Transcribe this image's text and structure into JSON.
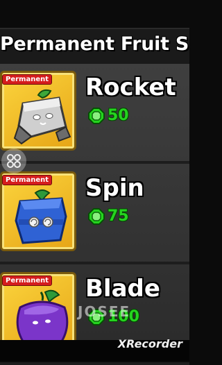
{
  "header": {
    "title": "Permanent Fruit Shop"
  },
  "items": [
    {
      "name": "Rocket",
      "price": "50",
      "badge": "Permanent"
    },
    {
      "name": "Spin",
      "price": "75",
      "badge": "Permanent"
    },
    {
      "name": "Blade",
      "price": "100",
      "badge": "Permanent"
    }
  ],
  "overlay": {
    "watermark": "JOSEE",
    "recorder": "XRecorder"
  },
  "colors": {
    "card_gold": "#f5c22a",
    "price_green": "#25d41f",
    "badge_red": "#d51d1d"
  },
  "icons": {
    "coin": "green-octagon-coin-icon",
    "inventory": "grid-icon"
  }
}
